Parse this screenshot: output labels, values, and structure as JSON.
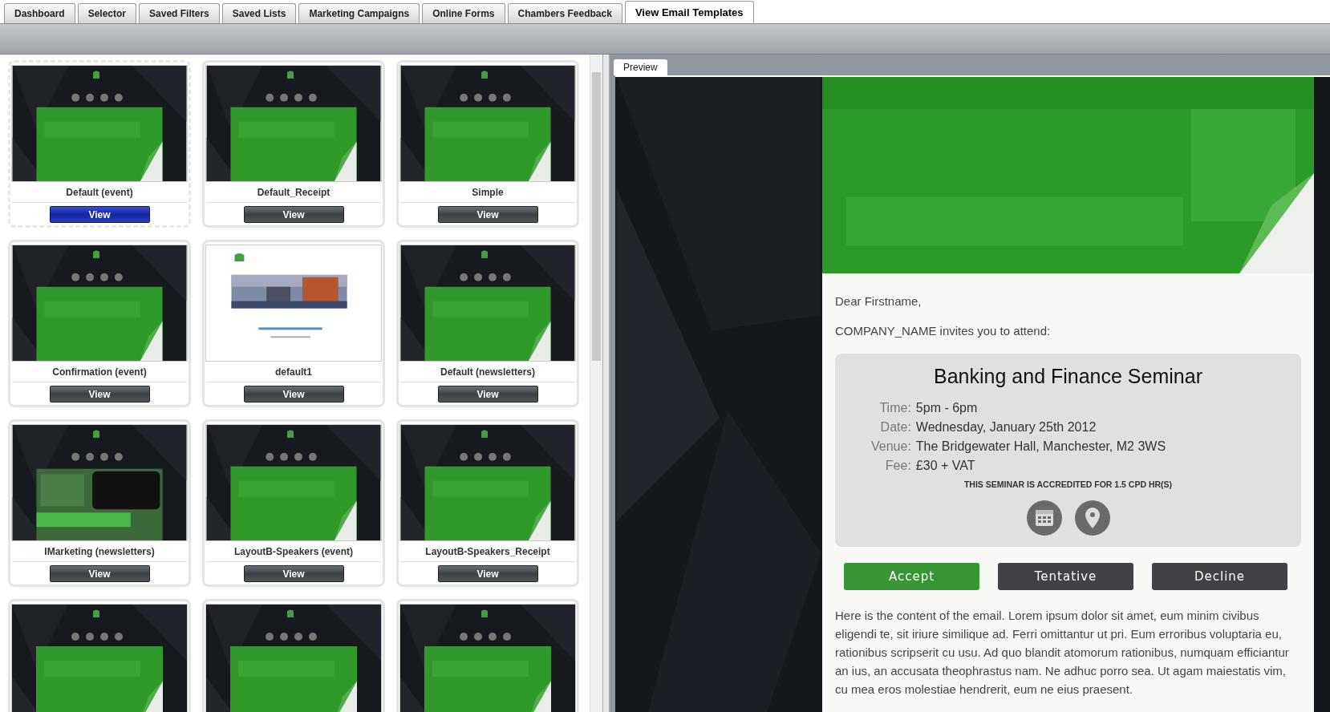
{
  "tabs": [
    {
      "label": "Dashboard",
      "selected": false
    },
    {
      "label": "Selector",
      "selected": false
    },
    {
      "label": "Saved Filters",
      "selected": false
    },
    {
      "label": "Saved Lists",
      "selected": false
    },
    {
      "label": "Marketing Campaigns",
      "selected": false
    },
    {
      "label": "Online Forms",
      "selected": false
    },
    {
      "label": "Chambers Feedback",
      "selected": false
    },
    {
      "label": "View Email Templates",
      "selected": true
    }
  ],
  "templates": [
    {
      "name": "Default (event)",
      "kind": "example",
      "selected": true,
      "button": "View"
    },
    {
      "name": "Default_Receipt",
      "kind": "example",
      "selected": false,
      "button": "View"
    },
    {
      "name": "Simple",
      "kind": "example",
      "selected": false,
      "button": "View"
    },
    {
      "name": "Confirmation (event)",
      "kind": "example",
      "selected": false,
      "button": "View"
    },
    {
      "name": "default1",
      "selected": false,
      "button": "View"
    },
    {
      "name": "Default (newsletters)",
      "kind": "example",
      "selected": false,
      "button": "View"
    },
    {
      "name": "IMarketing (newsletters)",
      "kind": "marketing",
      "selected": false,
      "button": "View"
    },
    {
      "name": "LayoutB-Speakers (event)",
      "kind": "example",
      "selected": false,
      "button": "View"
    },
    {
      "name": "LayoutB-Speakers_Receipt",
      "kind": "example",
      "selected": false,
      "button": "View"
    },
    {
      "kind": "example",
      "selected": false
    },
    {
      "kind": "example",
      "selected": false
    },
    {
      "kind": "example",
      "selected": false
    }
  ],
  "preview": {
    "tab": "Preview",
    "greeting": "Dear Firstname,",
    "invite": "COMPANY_NAME invites you to attend:",
    "event": {
      "title": "Banking and Finance Seminar",
      "details": [
        {
          "label": "Time:",
          "value": "5pm - 6pm"
        },
        {
          "label": "Date:",
          "value": "Wednesday, January 25th 2012"
        },
        {
          "label": "Venue:",
          "value": "The Bridgewater Hall, Manchester, M2 3WS"
        },
        {
          "label": "Fee:",
          "value": "£30 + VAT"
        }
      ],
      "note": "THIS SEMINAR IS ACCREDITED FOR 1.5 CPD HR(S)"
    },
    "responses": [
      {
        "label": "Accept",
        "kind": "primary"
      },
      {
        "label": "Tentative",
        "kind": "secondary"
      },
      {
        "label": "Decline",
        "kind": "secondary"
      }
    ],
    "body": "Here is the content of the email. Lorem ipsum dolor sit amet, eum minim civibus eligendi te, sit iriure similique ad. Ferri omittantur ut pri. Eum erroribus voluptaria eu, rationibus scripserit cu usu. Ad quo blandit atomorum rationibus, numquam efficiantur an ius, an accusata theophrastus nam. Ne adhuc porro sea. Ut agam maiestatis vim, cu mea eros molestiae hendrerit, eum ne eius praesent."
  }
}
